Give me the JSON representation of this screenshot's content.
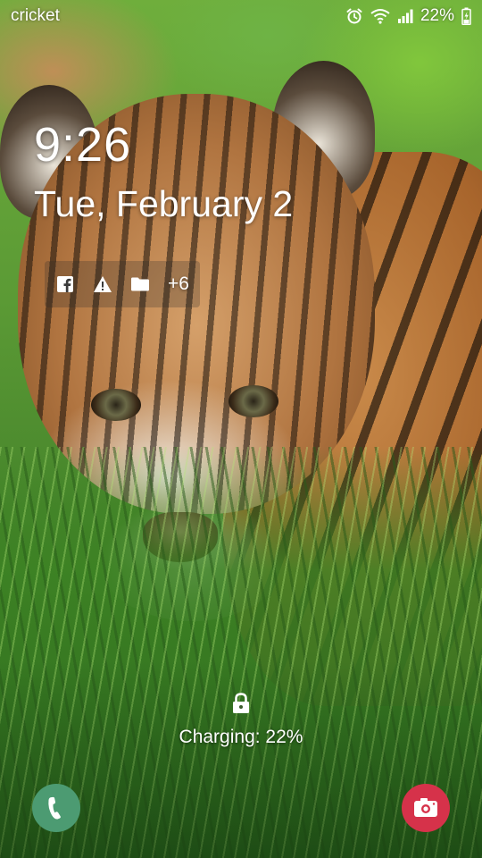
{
  "status_bar": {
    "carrier": "cricket",
    "battery_percent": "22%",
    "icons": [
      "alarm-icon",
      "wifi-icon",
      "signal-icon",
      "battery-charging-icon"
    ]
  },
  "lockscreen": {
    "time": "9:26",
    "date": "Tue, February 2",
    "notification_icons": [
      "facebook-icon",
      "warning-icon",
      "folder-icon"
    ],
    "notification_more": "+6",
    "charging_text": "Charging: 22%"
  },
  "shortcuts": {
    "left": "phone-icon",
    "right": "camera-icon"
  },
  "colors": {
    "phone_shortcut": "#4c9b72",
    "camera_shortcut": "#d6324a",
    "text": "#ffffff"
  }
}
